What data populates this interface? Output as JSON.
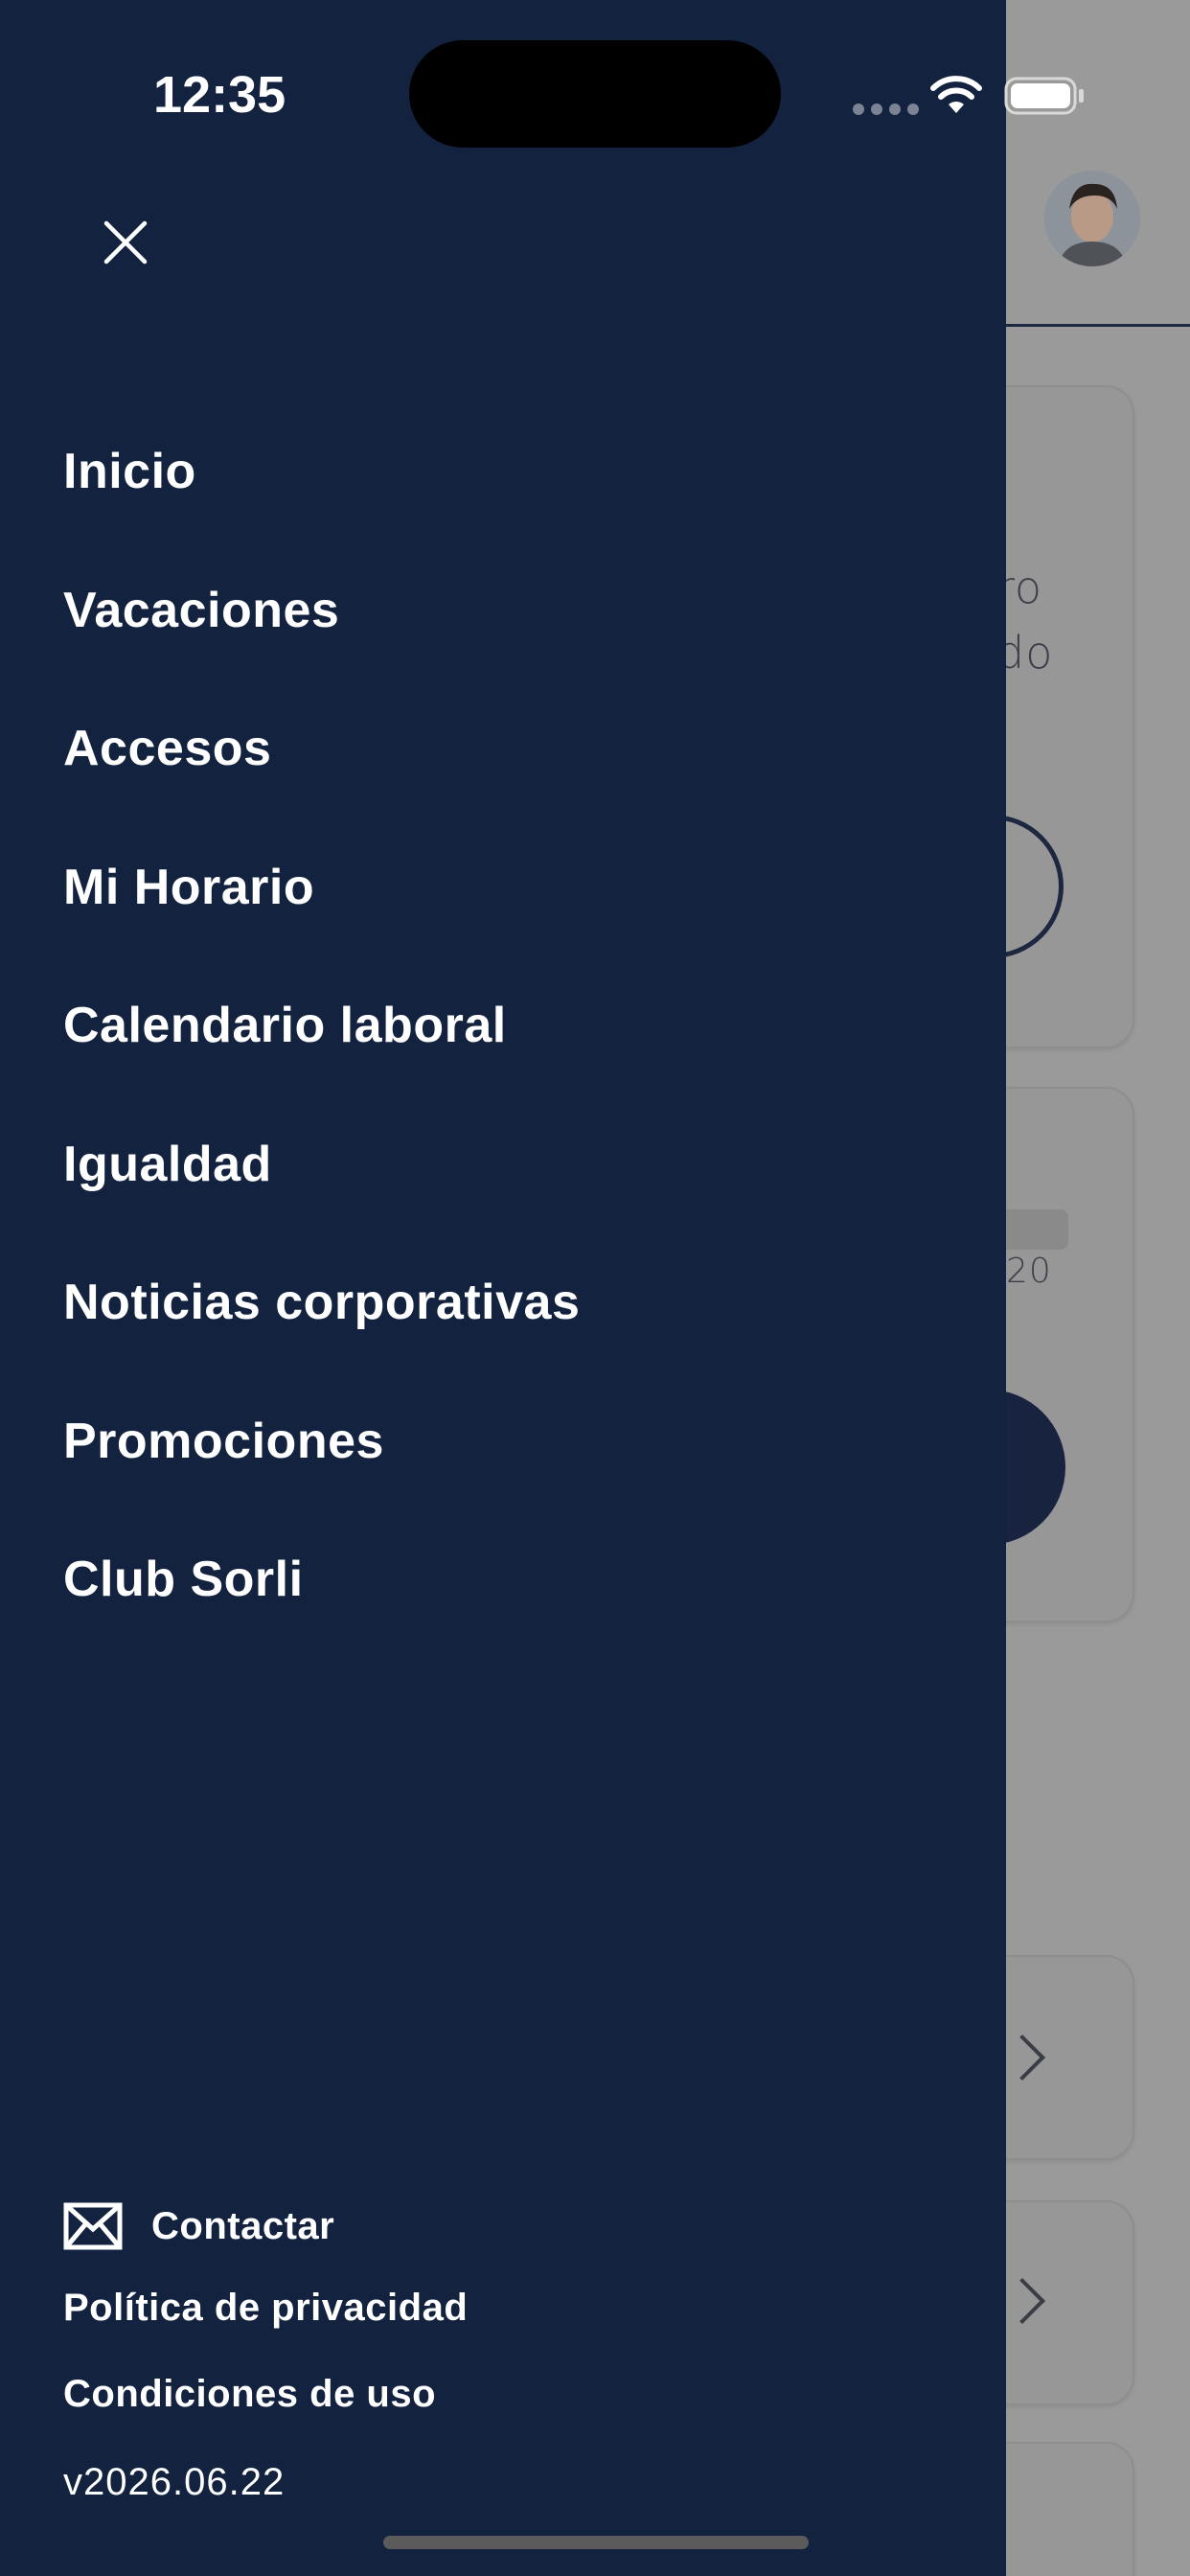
{
  "status_bar": {
    "time": "12:35"
  },
  "drawer": {
    "close_icon": "close-icon",
    "menu_items": [
      {
        "label": "Inicio"
      },
      {
        "label": "Vacaciones"
      },
      {
        "label": "Accesos"
      },
      {
        "label": "Mi Horario"
      },
      {
        "label": "Calendario laboral"
      },
      {
        "label": "Igualdad"
      },
      {
        "label": "Noticias corporativas"
      },
      {
        "label": "Promociones"
      },
      {
        "label": "Club Sorli"
      }
    ],
    "footer": {
      "contact_label": "Contactar",
      "privacy_label": "Política de privacidad",
      "terms_label": "Condiciones de uso",
      "version": "v2026.06.22"
    }
  },
  "background": {
    "card1_text_line1": "ro",
    "card1_text_line2": "do",
    "card2_text": "20"
  },
  "colors": {
    "drawer_bg": "#12223f",
    "overlay": "#9a9a9a",
    "text": "#ffffff"
  }
}
